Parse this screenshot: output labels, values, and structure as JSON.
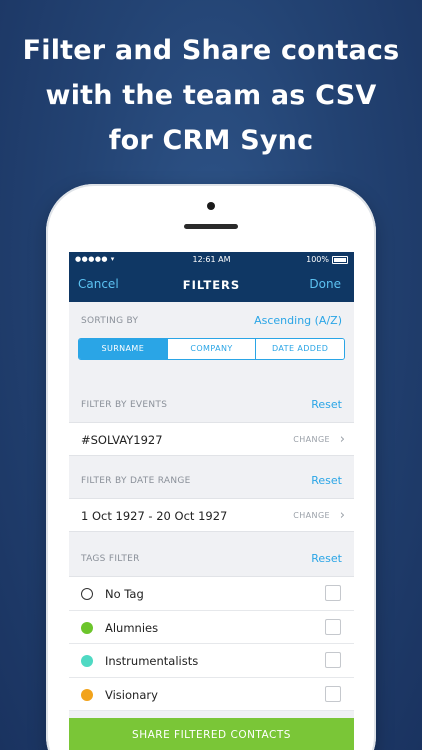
{
  "headline": {
    "line1": "Filter and Share contacs",
    "line2": "with the team as CSV",
    "line3": "for CRM Sync"
  },
  "statusbar": {
    "signal": "●●●●● ",
    "time": "12:61 AM",
    "battery": "100%"
  },
  "navbar": {
    "cancel": "Cancel",
    "title": "FILTERS",
    "done": "Done"
  },
  "sorting": {
    "label": "SORTING BY",
    "value": "Ascending (A/Z)",
    "options": [
      "SURNAME",
      "COMPANY",
      "DATE ADDED"
    ],
    "selected": "SURNAME"
  },
  "events": {
    "label": "FILTER BY EVENTS",
    "reset": "Reset",
    "value": "#SOLVAY1927",
    "change": "CHANGE"
  },
  "daterange": {
    "label": "FILTER BY DATE RANGE",
    "reset": "Reset",
    "value": "1 Oct 1927 - 20 Oct 1927",
    "change": "CHANGE"
  },
  "tags": {
    "label": "TAGS FILTER",
    "reset": "Reset",
    "items": [
      {
        "label": "No Tag",
        "color": ""
      },
      {
        "label": "Alumnies",
        "color": "#6cc52b"
      },
      {
        "label": "Instrumentalists",
        "color": "#4fd9c3"
      },
      {
        "label": "Visionary",
        "color": "#f2a31b"
      }
    ]
  },
  "share": {
    "label": "SHARE FILTERED CONTACTS"
  },
  "colors": {
    "accent": "#2aa5e6",
    "navbar": "#0f3764",
    "share_button": "#7ac637"
  }
}
